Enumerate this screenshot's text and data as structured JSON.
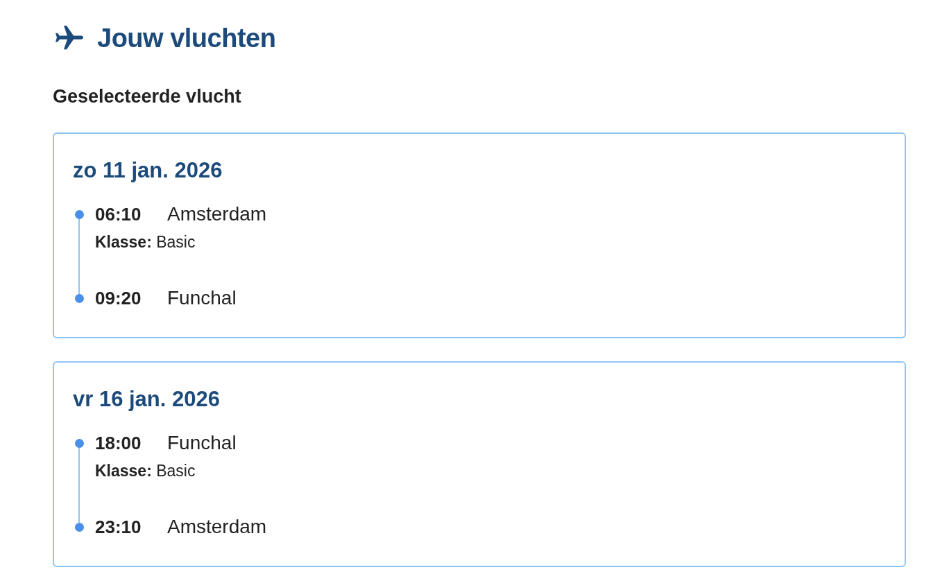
{
  "header": {
    "title": "Jouw vluchten"
  },
  "section_title": "Geselecteerde vlucht",
  "flights": [
    {
      "date": "zo 11 jan. 2026",
      "departure": {
        "time": "06:10",
        "place": "Amsterdam"
      },
      "class_info": "**Klasse:** Basic",
      "arrival": {
        "time": "09:20",
        "place": "Funchal"
      }
    },
    {
      "date": "vr 16 jan. 2026",
      "departure": {
        "time": "18:00",
        "place": "Funchal"
      },
      "class_info": "**Klasse:** Basic",
      "arrival": {
        "time": "23:10",
        "place": "Amsterdam"
      }
    }
  ]
}
